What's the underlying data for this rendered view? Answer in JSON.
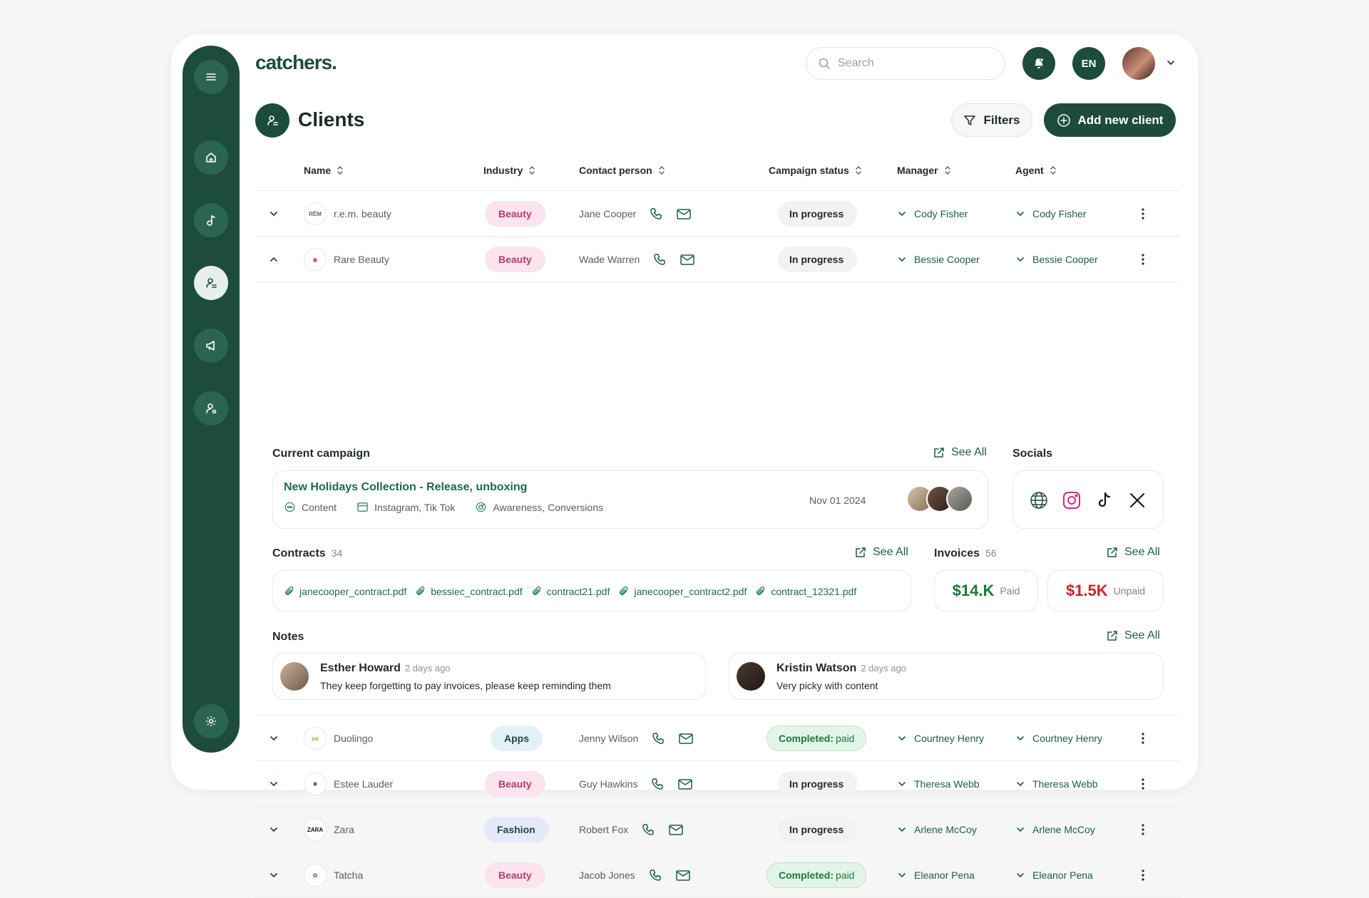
{
  "app": {
    "logo": "catchers."
  },
  "header": {
    "search_placeholder": "Search",
    "language": "EN",
    "notifications_icon": "bell-icon"
  },
  "page": {
    "title": "Clients",
    "filters_label": "Filters",
    "add_label": "Add new client"
  },
  "sidebar": {
    "items": [
      {
        "icon": "menu-icon"
      },
      {
        "icon": "home-icon"
      },
      {
        "icon": "music-note-icon"
      },
      {
        "icon": "clients-icon",
        "active": true
      },
      {
        "icon": "megaphone-icon"
      },
      {
        "icon": "agent-icon"
      },
      {
        "icon": "gear-icon"
      }
    ]
  },
  "table": {
    "columns": [
      "Name",
      "Industry",
      "Contact person",
      "Campaign status",
      "Manager",
      "Agent"
    ],
    "rows": [
      {
        "name": "r.e.m. beauty",
        "industry": "Beauty",
        "contact": "Jane Cooper",
        "status": "In progress",
        "status_sub": "",
        "manager": "Cody Fisher",
        "agent": "Cody Fisher"
      },
      {
        "name": "Rare Beauty",
        "industry": "Beauty",
        "contact": "Wade Warren",
        "status": "In progress",
        "status_sub": "",
        "manager": "Bessie Cooper",
        "agent": "Bessie Cooper"
      },
      {
        "name": "Duolingo",
        "industry": "Apps",
        "contact": "Jenny Wilson",
        "status": "Completed:",
        "status_sub": "paid",
        "manager": "Courtney Henry",
        "agent": "Courtney Henry"
      },
      {
        "name": "Estee Lauder",
        "industry": "Beauty",
        "contact": "Guy Hawkins",
        "status": "In progress",
        "status_sub": "",
        "manager": "Theresa Webb",
        "agent": "Theresa Webb"
      },
      {
        "name": "Zara",
        "industry": "Fashion",
        "contact": "Robert Fox",
        "status": "In progress",
        "status_sub": "",
        "manager": "Arlene McCoy",
        "agent": "Arlene McCoy"
      },
      {
        "name": "Tatcha",
        "industry": "Beauty",
        "contact": "Jacob Jones",
        "status": "Completed:",
        "status_sub": "paid",
        "manager": "Eleanor Pena",
        "agent": "Eleanor Pena"
      }
    ]
  },
  "details": {
    "campaign": {
      "section_title": "Current campaign",
      "see_all": "See All",
      "title": "New Holidays Collection - Release, unboxing",
      "type": "Content",
      "platforms": "Instagram, Tik Tok",
      "goals": "Awareness, Conversions",
      "date": "Nov 01 2024"
    },
    "socials": {
      "section_title": "Socials",
      "icons": [
        "globe-icon",
        "instagram-icon",
        "tiktok-icon",
        "x-icon"
      ]
    },
    "contracts": {
      "section_title": "Contracts",
      "count": "34",
      "see_all": "See All",
      "files": [
        "janecooper_contract.pdf",
        "bessiec_contract.pdf",
        "contract21.pdf",
        "janecooper_contract2.pdf",
        "contract_12321.pdf"
      ]
    },
    "invoices": {
      "section_title": "Invoices",
      "count": "56",
      "see_all": "See All",
      "paid_amount": "$14.K",
      "paid_label": "Paid",
      "unpaid_amount": "$1.5K",
      "unpaid_label": "Unpaid",
      "paid_color": "#187a3c",
      "unpaid_color": "#c4262e"
    },
    "notes": {
      "section_title": "Notes",
      "see_all": "See All",
      "items": [
        {
          "author": "Esther Howard",
          "ago": "2 days ago",
          "text": "They keep forgetting to pay invoices, please keep reminding them"
        },
        {
          "author": "Kristin Watson",
          "ago": "2 days ago",
          "text": "Very picky with content"
        }
      ]
    }
  },
  "colors": {
    "brand": "#1d4c3e",
    "accent_text": "#1d6a4f"
  }
}
